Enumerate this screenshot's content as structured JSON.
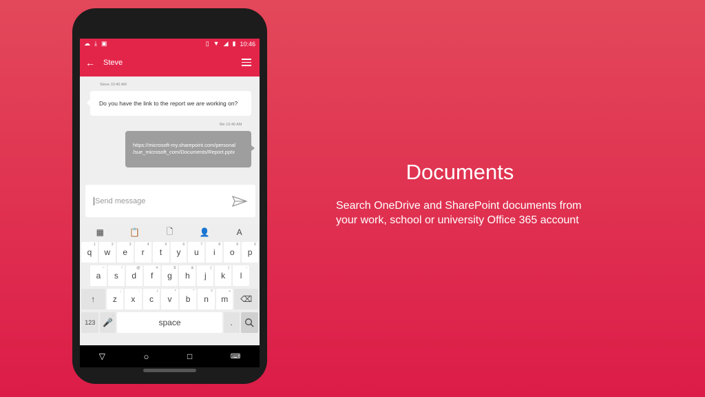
{
  "status_bar": {
    "time": "10:46"
  },
  "app_bar": {
    "title": "Steve"
  },
  "chat": {
    "incoming_meta": "Steve 10:40 AM",
    "incoming_text": "Do you have the link to the report we are working on?",
    "outgoing_meta": "Me 10:46 AM",
    "outgoing_line1": "https://microsoft-my.sharepoint.com/personal",
    "outgoing_line2": "/sue_microsoft_com/Documents/Report.pptx"
  },
  "compose": {
    "placeholder": "Send message"
  },
  "keyboard": {
    "row1": [
      [
        "q",
        "1"
      ],
      [
        "w",
        "2"
      ],
      [
        "e",
        "3"
      ],
      [
        "r",
        "4"
      ],
      [
        "t",
        "5"
      ],
      [
        "y",
        "6"
      ],
      [
        "u",
        "7"
      ],
      [
        "i",
        "8"
      ],
      [
        "o",
        "9"
      ],
      [
        "p",
        "0"
      ]
    ],
    "row2": [
      [
        "a",
        "~"
      ],
      [
        "s",
        "!"
      ],
      [
        "d",
        "@"
      ],
      [
        "f",
        "#"
      ],
      [
        "g",
        "$"
      ],
      [
        "h",
        "&"
      ],
      [
        "j",
        "("
      ],
      [
        "k",
        ")"
      ],
      [
        "l",
        "-"
      ]
    ],
    "row3": [
      [
        "z",
        ";"
      ],
      [
        "x",
        ":"
      ],
      [
        "c",
        "/"
      ],
      [
        "v",
        "*"
      ],
      [
        "b",
        "\""
      ],
      [
        "n",
        "?"
      ],
      [
        "m",
        "+"
      ]
    ],
    "num_key": "123",
    "space_key": "space",
    "period_key": ".",
    "comma_hint": ","
  },
  "promo": {
    "title": "Documents",
    "line1": "Search OneDrive and SharePoint documents from",
    "line2": "your work, school or university Office 365 account"
  },
  "colors": {
    "brand": "#e4254a",
    "background": "#dc1c48"
  }
}
